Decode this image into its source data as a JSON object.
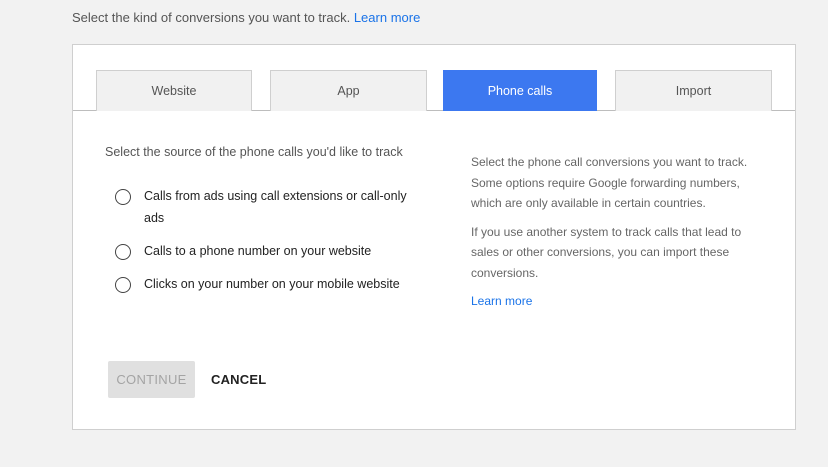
{
  "intro": {
    "text": "Select the kind of conversions you want to track.",
    "link": "Learn more"
  },
  "tabs": [
    {
      "label": "Website",
      "active": false
    },
    {
      "label": "App",
      "active": false
    },
    {
      "label": "Phone calls",
      "active": true
    },
    {
      "label": "Import",
      "active": false
    }
  ],
  "source": {
    "heading": "Select the source of the phone calls you'd like to track",
    "options": [
      {
        "label": "Calls from ads using call extensions or call-only ads",
        "selected": false
      },
      {
        "label": "Calls to a phone number on your website",
        "selected": false
      },
      {
        "label": "Clicks on your number on your mobile website",
        "selected": false
      }
    ]
  },
  "help": {
    "paragraph1": "Select the phone call conversions you want to track. Some options require Google forwarding numbers, which are only available in certain countries.",
    "paragraph2": "If you use another system to track calls that lead to sales or other conversions, you can import these conversions.",
    "link": "Learn more"
  },
  "actions": {
    "continue_label": "CONTINUE",
    "cancel_label": "CANCEL"
  },
  "colors": {
    "active_tab": "#3c78f0",
    "link": "#1a73e8"
  }
}
